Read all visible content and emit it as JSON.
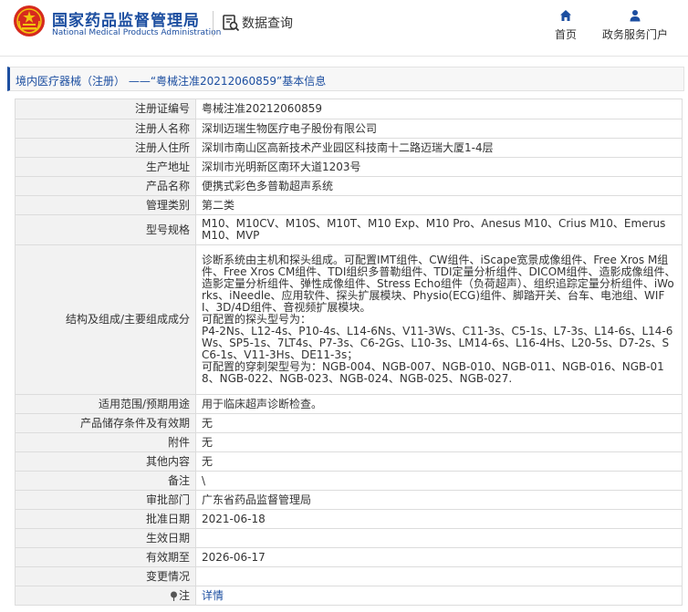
{
  "header": {
    "brand_cn": "国家药品监督管理局",
    "brand_en": "National Medical Products Administration",
    "query_title": "数据查询",
    "nav": [
      {
        "label": "首页",
        "icon": "home-icon"
      },
      {
        "label": "政务服务门户",
        "icon": "user-icon"
      }
    ]
  },
  "breadcrumb": "境内医疗器械（注册） ——“粤械注准20212060859”基本信息",
  "rows": [
    {
      "label": "注册证编号",
      "value": "粤械注准20212060859"
    },
    {
      "label": "注册人名称",
      "value": "深圳迈瑞生物医疗电子股份有限公司"
    },
    {
      "label": "注册人住所",
      "value": "深圳市南山区高新技术产业园区科技南十二路迈瑞大厦1-4层"
    },
    {
      "label": "生产地址",
      "value": "深圳市光明新区南环大道1203号"
    },
    {
      "label": "产品名称",
      "value": "便携式彩色多普勒超声系统"
    },
    {
      "label": "管理类别",
      "value": "第二类"
    },
    {
      "label": "型号规格",
      "value": "M10、M10CV、M10S、M10T、M10 Exp、M10 Pro、Anesus M10、Crius M10、Emerus M10、MVP"
    },
    {
      "label": "结构及组成/主要组成成分",
      "value": "诊断系统由主机和探头组成。可配置IMT组件、CW组件、iScape宽景成像组件、Free Xros M组件、Free Xros CM组件、TDI组织多普勒组件、TDI定量分析组件、DICOM组件、造影成像组件、造影定量分析组件、弹性成像组件、Stress Echo组件（负荷超声）、组织追踪定量分析组件、iWorks、iNeedle、应用软件、探头扩展模块、Physio(ECG)组件、脚踏开关、台车、电池组、WIFI、3D/4D组件、音视频扩展模块。\n可配置的探头型号为：\nP4-2Ns、L12-4s、P10-4s、L14-6Ns、V11-3Ws、C11-3s、C5-1s、L7-3s、L14-6s、L14-6Ws、SP5-1s、7LT4s、P7-3s、C6-2Gs、L10-3s、LM14-6s、L16-4Hs、L20-5s、D7-2s、SC6-1s、V11-3Hs、DE11-3s；\n可配置的穿刺架型号为：NGB-004、NGB-007、NGB-010、NGB-011、NGB-016、NGB-018、NGB-022、NGB-023、NGB-024、NGB-025、NGB-027."
    },
    {
      "label": "适用范围/预期用途",
      "value": "用于临床超声诊断检查。"
    },
    {
      "label": "产品储存条件及有效期",
      "value": "无"
    },
    {
      "label": "附件",
      "value": "无"
    },
    {
      "label": "其他内容",
      "value": "无"
    },
    {
      "label": "备注",
      "value": "\\"
    },
    {
      "label": "审批部门",
      "value": "广东省药品监督管理局"
    },
    {
      "label": "批准日期",
      "value": "2021-06-18"
    },
    {
      "label": "生效日期",
      "value": ""
    },
    {
      "label": "有效期至",
      "value": "2026-06-17"
    },
    {
      "label": "变更情况",
      "value": ""
    }
  ],
  "note": {
    "label": "注",
    "link": "详情",
    "icon": "pin-icon"
  },
  "colors": {
    "brand": "#1c4ea0",
    "label_bg": "#f2f2f2",
    "border": "#dcdcdc"
  }
}
